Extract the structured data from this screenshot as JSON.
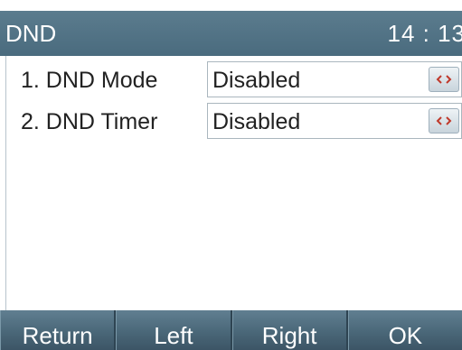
{
  "header": {
    "title": "DND",
    "clock": "14 : 13"
  },
  "menu": {
    "items": [
      {
        "label": "1. DND Mode",
        "value": "Disabled",
        "selector_icon": "left-right-arrows-icon"
      },
      {
        "label": "2. DND Timer",
        "value": "Disabled",
        "selector_icon": "left-right-arrows-icon"
      }
    ]
  },
  "softkeys": {
    "return_label": "Return",
    "left_label": "Left",
    "right_label": "Right",
    "ok_label": "OK"
  },
  "colors": {
    "title_bar": "#4f7083",
    "softkey_bar": "#4a6778",
    "selector_arrow": "#c0392b"
  }
}
